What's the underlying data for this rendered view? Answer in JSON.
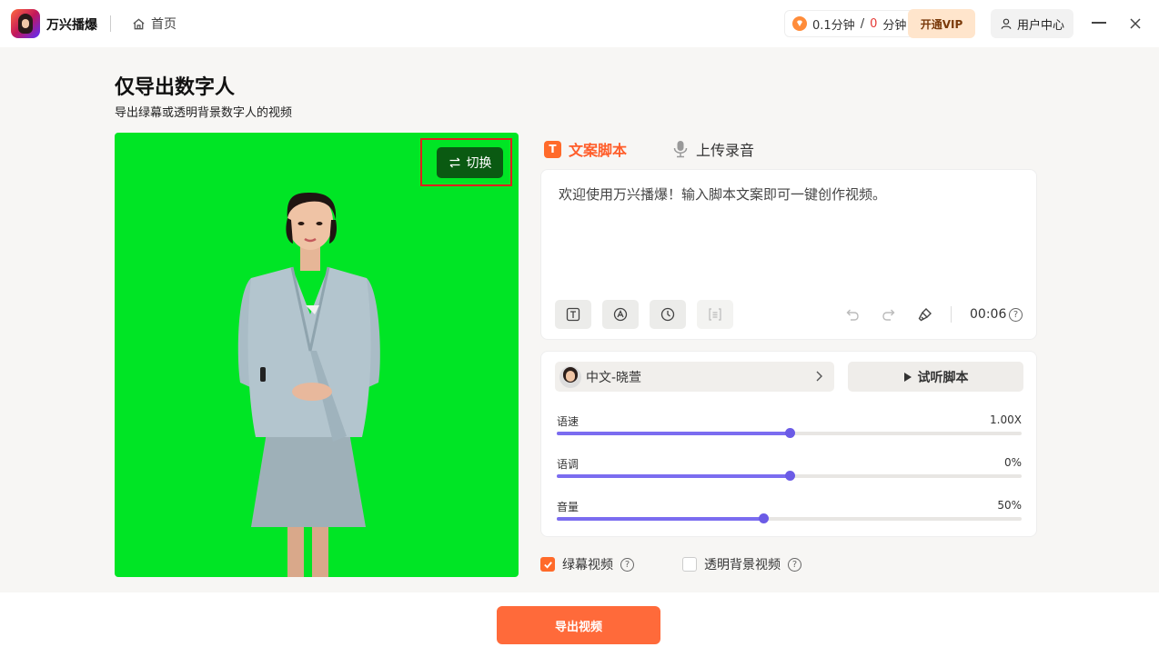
{
  "app": {
    "name": "万兴播爆",
    "home_label": "首页"
  },
  "titlebar": {
    "balance_available": "0.1分钟",
    "balance_sep": "/",
    "balance_used": "0",
    "balance_unit": "分钟",
    "vip_label": "开通VIP",
    "user_center_label": "用户中心"
  },
  "page": {
    "title": "仅导出数字人",
    "subtitle": "导出绿幕或透明背景数字人的视频"
  },
  "preview": {
    "switch_label": "切换",
    "background_color": "#00e525"
  },
  "tabs": [
    {
      "label": "文案脚本",
      "active": true,
      "icon_text": "T"
    },
    {
      "label": "上传录音",
      "active": false
    }
  ],
  "script": {
    "placeholder": "欢迎使用万兴播爆！输入脚本文案即可一键创作视频。",
    "duration": "00:06",
    "help": "?"
  },
  "voice": {
    "name": "中文-晓萱",
    "try_label": "试听脚本"
  },
  "sliders": [
    {
      "label": "语速",
      "value_text": "1.00X",
      "fraction": 0.5
    },
    {
      "label": "语调",
      "value_text": "0%",
      "fraction": 0.5
    },
    {
      "label": "音量",
      "value_text": "50%",
      "fraction": 0.445
    }
  ],
  "options": {
    "green_label": "绿幕视频",
    "green_checked": true,
    "transparent_label": "透明背景视频",
    "transparent_checked": false,
    "help": "?"
  },
  "export": {
    "label": "导出视频"
  },
  "colors": {
    "accent": "#ff6a2a",
    "slider": "#7b6cf0"
  }
}
